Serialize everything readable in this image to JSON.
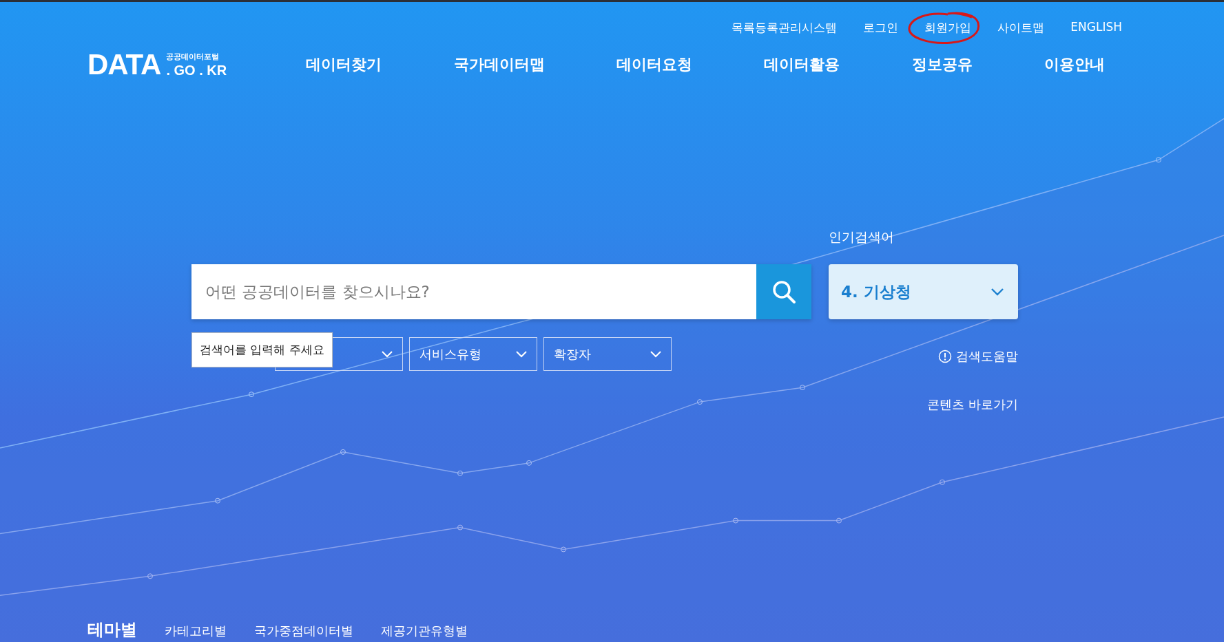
{
  "utility_links": [
    {
      "label": "목록등록관리시스템",
      "circled": false
    },
    {
      "label": "로그인",
      "circled": false
    },
    {
      "label": "회원가입",
      "circled": true
    },
    {
      "label": "사이트맵",
      "circled": false
    },
    {
      "label": "ENGLISH",
      "circled": false
    }
  ],
  "logo": {
    "main": "DATA",
    "sub_top": "공공데이터포털",
    "sub_bottom": ". GO . KR"
  },
  "nav": [
    "데이터찾기",
    "국가데이터맵",
    "데이터요청",
    "데이터활용",
    "정보공유",
    "이용안내"
  ],
  "search": {
    "placeholder": "어떤 공공데이터를 찾으시나요?"
  },
  "popular": {
    "label": "인기검색어",
    "value": "4. 기상청"
  },
  "filters": [
    {
      "kind": "covered"
    },
    {
      "kind": "labeled",
      "label": "서비스유형"
    },
    {
      "kind": "labeled",
      "label": "확장자"
    }
  ],
  "tooltip": "검색어를 입력해 주세요",
  "help_link": "검색도움말",
  "content_link": "콘텐츠 바로가기",
  "bottom_tabs": [
    {
      "label": "테마별",
      "selected": true
    },
    {
      "label": "카테고리별",
      "selected": false
    },
    {
      "label": "국가중점데이터별",
      "selected": false
    },
    {
      "label": "제공기관유형별",
      "selected": false
    }
  ]
}
